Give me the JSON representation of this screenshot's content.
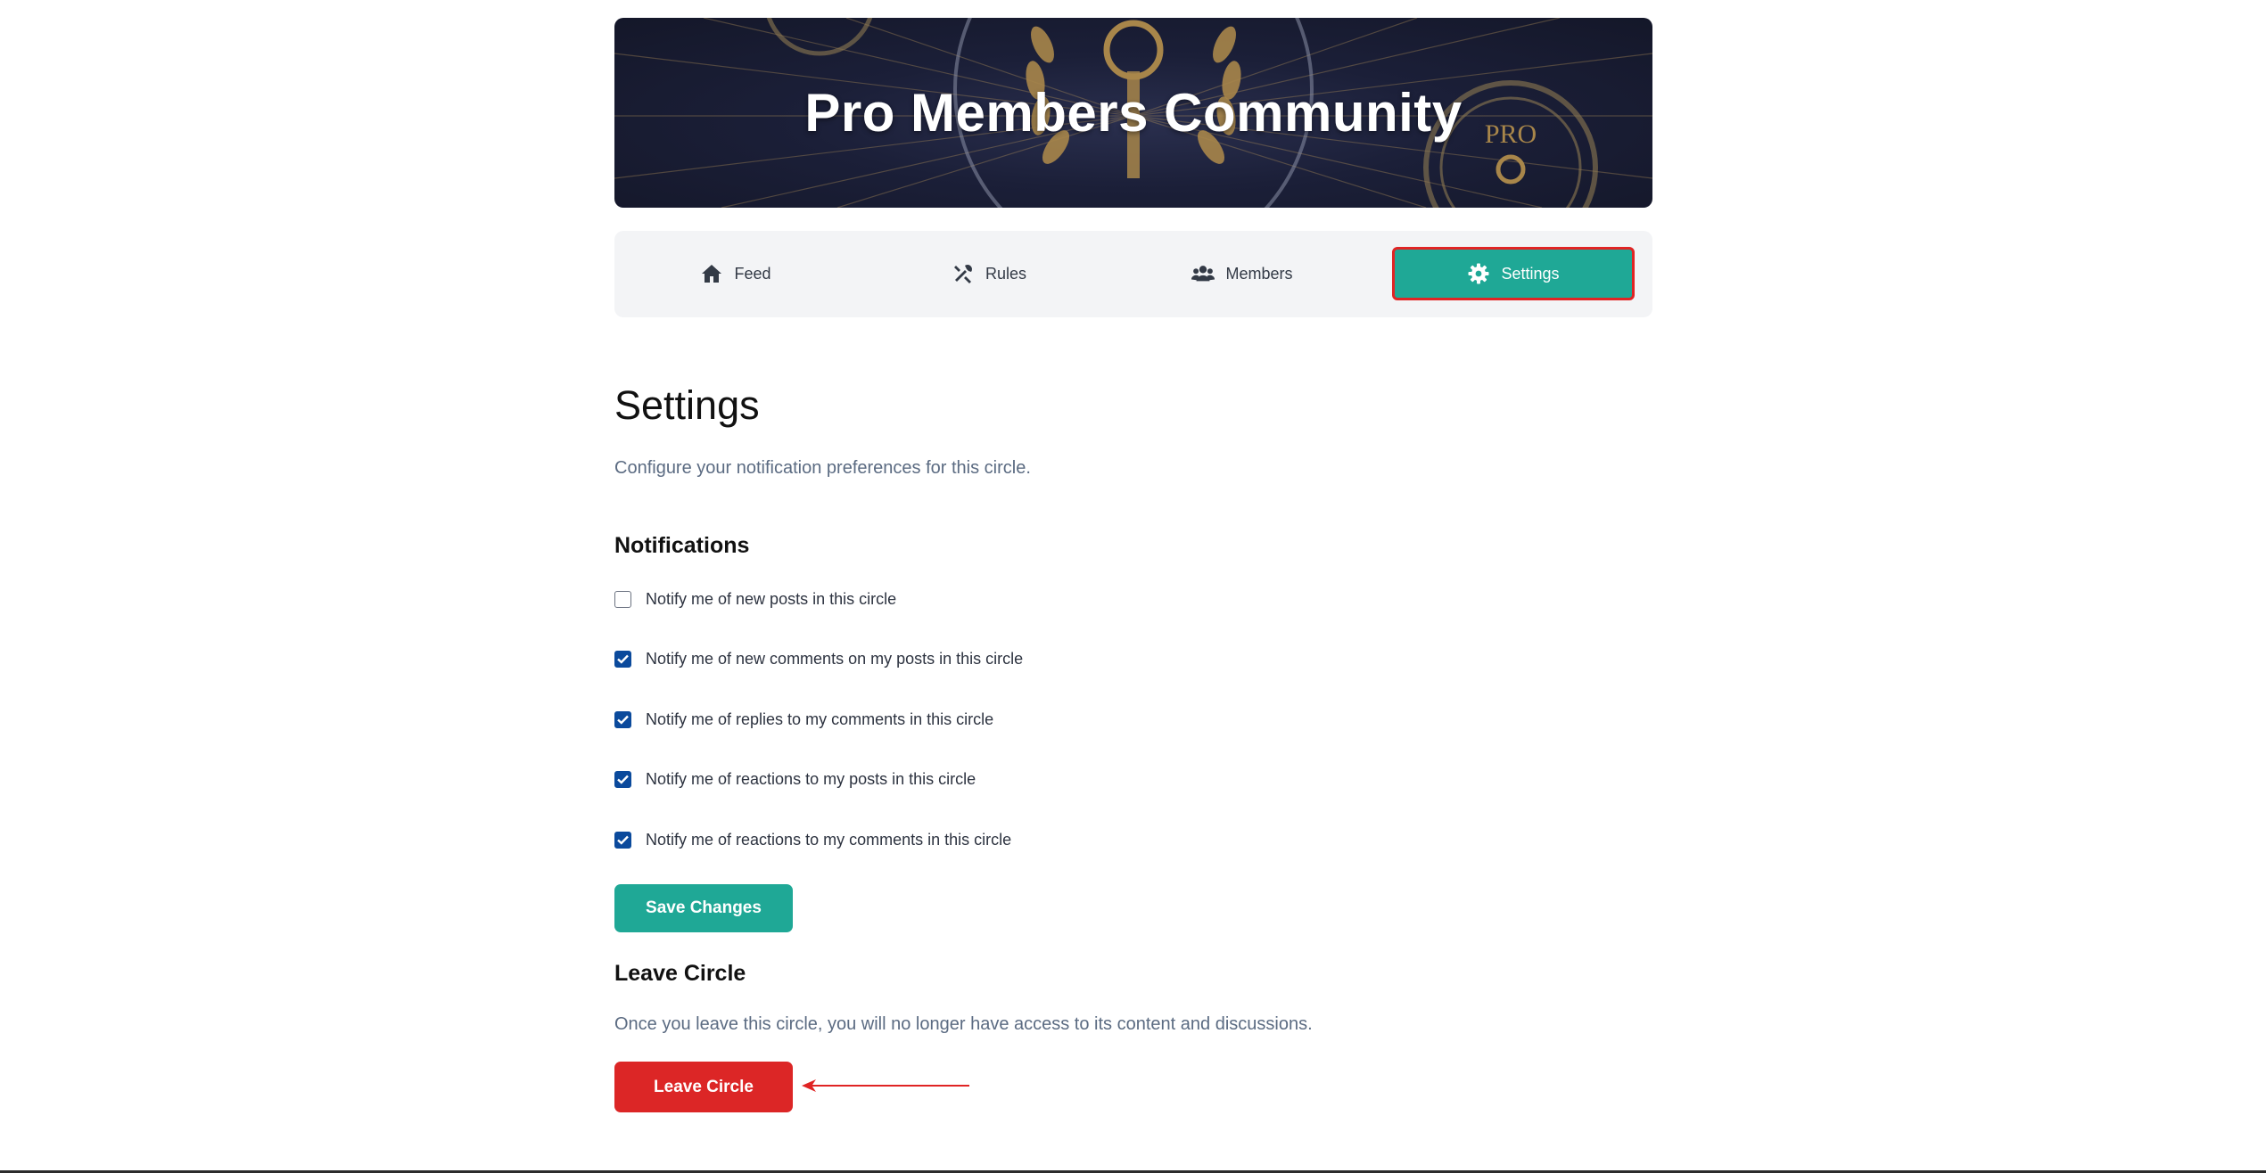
{
  "banner": {
    "title": "Pro Members Community",
    "emblem_text": "PRO"
  },
  "tabs": [
    {
      "label": "Feed",
      "icon": "home-icon",
      "active": false
    },
    {
      "label": "Rules",
      "icon": "tools-icon",
      "active": false
    },
    {
      "label": "Members",
      "icon": "users-icon",
      "active": false
    },
    {
      "label": "Settings",
      "icon": "gear-icon",
      "active": true
    }
  ],
  "settings": {
    "title": "Settings",
    "subtitle": "Configure your notification preferences for this circle."
  },
  "notifications": {
    "title": "Notifications",
    "options": [
      {
        "label": "Notify me of new posts in this circle",
        "checked": false
      },
      {
        "label": "Notify me of new comments on my posts in this circle",
        "checked": true
      },
      {
        "label": "Notify me of replies to my comments in this circle",
        "checked": true
      },
      {
        "label": "Notify me of reactions to my posts in this circle",
        "checked": true
      },
      {
        "label": "Notify me of reactions to my comments in this circle",
        "checked": true
      }
    ],
    "save_label": "Save Changes"
  },
  "leave": {
    "title": "Leave Circle",
    "description": "Once you leave this circle, you will no longer have access to its content and discussions.",
    "button_label": "Leave Circle"
  },
  "colors": {
    "accent": "#1fa896",
    "danger": "#dc2626",
    "checkbox": "#0b4a9c",
    "highlight": "#e02424"
  }
}
